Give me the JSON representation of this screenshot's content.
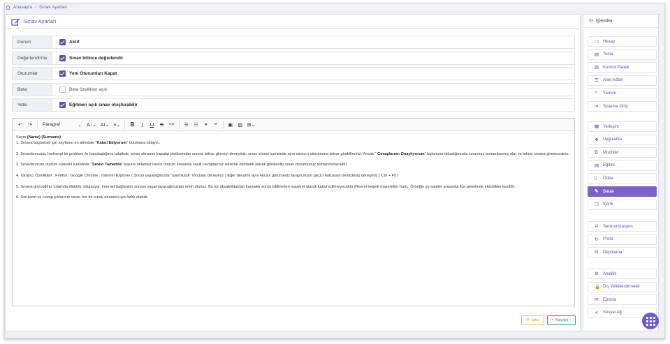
{
  "breadcrumb": {
    "home": "Anasayfa",
    "separator": "/",
    "current": "Sınav Ayarları"
  },
  "main": {
    "title": "Sınav Ayarları",
    "settings": [
      {
        "label": "Durum",
        "value": "Aktif",
        "checked": true
      },
      {
        "label": "Değerlendirme",
        "value": "Sınav bitince değerlendir",
        "checked": true
      },
      {
        "label": "Oturumlar",
        "value": "Yeni Oturumları Kapat",
        "checked": true
      },
      {
        "label": "Beta",
        "value": "Beta özellikler açık",
        "checked": false
      },
      {
        "label": "Yetki",
        "value": "Eğitmen açık sınav oluşturabilir",
        "checked": true
      }
    ],
    "editor": {
      "paragraph_select": "Paragraf",
      "content": [
        {
          "pre": "Sayın ",
          "b1": "(Name) (Surname)"
        },
        {
          "pre": "1. Sınava başlamak için sayfanın en altındaki \"",
          "b1": "Kabul Ediyorum",
          "post": "\" butonuna tıklayın."
        },
        {
          "pre": "2. Sınavlarınızda, herhangi bir problem ile karşılaştığınız takdirde, sınav ekranını kapatıp platformdan sınava tekrar girmeyi deneyiniz; sınav süresi içerisinde aynı sınavın oturumuna tekrar girebilirsiniz. Ancak \" ",
          "b1": "Cevaplarımı Onaylıyorum",
          "post": "\" butonuna tıkladığınızda sınavınız tamamlanmış olur ve tekrar sınava giremezsiniz."
        },
        {
          "pre": "3. Sınavlarınızın oturum süresini içerisinde \"",
          "b1": "Sınavı Tamamla",
          "post": "\" tuşuna tıklamaz iseniz oturum sonunda seçili cevaplarınız sisteme otomatik olarak gönderilip sınav oturumunuz sonlandırılacaktır."
        },
        {
          "pre": "4. Tarayıcı Özellikleri : Firefox , Google Chrome , Internet Explorer ( Sorun yaşadığınızda \"uyumluluk\" modunu deneyiniz ) Eğer devamlı aynı ekranı görürseniz tarayıcınızın geçici hafızasını temizleyip deneyiniz ( Ctrl + F5 )"
        },
        {
          "pre": "5. Sınava gireceğiniz ortamda elektrik, bilgisayar, internet bağlantısı sorunu yaşamayacağınızdan emin olunuz. Bu tür aksaklıklardan kaynaklı sorun bildirimleri mazeret olarak kabul edilmeyecektir (Resmi belgeli mazeretler hariç. Örneğin şu saatler arasında ilçe genelinde elektrikler kesildi)."
        },
        {
          "pre": "6. Soruların ve cevap şıklarının sırası her bir sınav oturumu için farklı olabilir."
        }
      ]
    },
    "cancel_label": "İptal",
    "save_label": "Kaydet"
  },
  "sidebar": {
    "title": "İşlemler",
    "groups": [
      [
        {
          "label": "Hesap",
          "icon": "monitor-icon"
        },
        {
          "label": "Tema",
          "icon": "window-icon"
        },
        {
          "label": "Kontrol Paneli",
          "icon": "bar-chart-icon"
        },
        {
          "label": "Alan Adları",
          "icon": "list-icon"
        },
        {
          "label": "Yardım",
          "icon": "question-icon"
        },
        {
          "label": "Sisteme Giriş",
          "icon": "sign-in-icon"
        }
      ],
      [
        {
          "label": "Yerleşim",
          "icon": "layout-icon"
        },
        {
          "label": "Uygulama",
          "icon": "dropbox-icon"
        },
        {
          "label": "Modüller",
          "icon": "sitemap-icon"
        },
        {
          "label": "Eğitim",
          "icon": "book-icon"
        },
        {
          "label": "Ödev",
          "icon": "file-icon"
        },
        {
          "label": "Sınav",
          "icon": "edit-icon",
          "active": true
        },
        {
          "label": "İçerik",
          "icon": "copy-icon"
        }
      ],
      [
        {
          "label": "Senkronizasyon",
          "icon": "sync-icon"
        },
        {
          "label": "Proliz",
          "icon": "refresh-icon"
        },
        {
          "label": "Depolama",
          "icon": "drive-icon"
        }
      ],
      [
        {
          "label": "Analitik",
          "icon": "cog-icon"
        },
        {
          "label": "Dış Yetkilendirmeler",
          "icon": "lock-icon"
        },
        {
          "label": "Eposta",
          "icon": "envelope-icon"
        },
        {
          "label": "Sosyal Ağ",
          "icon": "share-icon"
        }
      ]
    ]
  },
  "colors": {
    "accent": "#5b4fb0",
    "active_bg": "#7b63c8",
    "save": "#2a8a56",
    "cancel": "#e0a020"
  }
}
